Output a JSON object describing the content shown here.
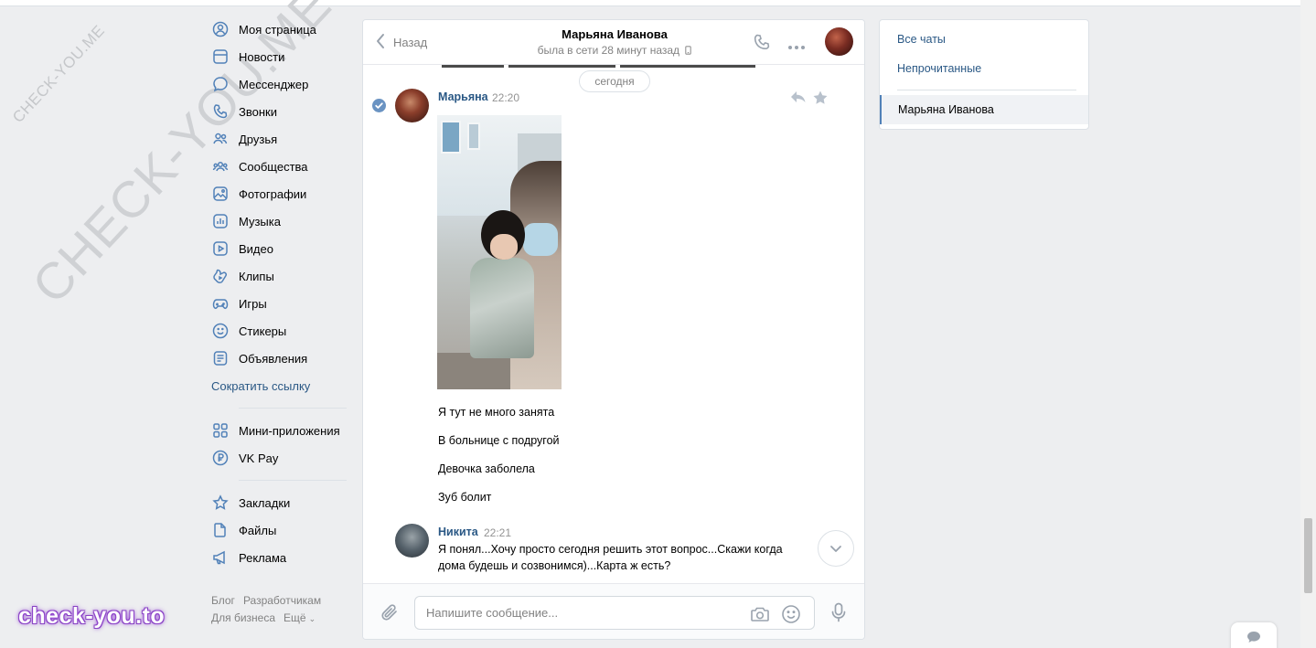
{
  "nav": {
    "items": [
      {
        "label": "Моя страница",
        "icon": "user-circle-icon"
      },
      {
        "label": "Новости",
        "icon": "news-icon"
      },
      {
        "label": "Мессенджер",
        "icon": "message-icon"
      },
      {
        "label": "Звонки",
        "icon": "phone-icon"
      },
      {
        "label": "Друзья",
        "icon": "friends-icon"
      },
      {
        "label": "Сообщества",
        "icon": "communities-icon"
      },
      {
        "label": "Фотографии",
        "icon": "photo-icon"
      },
      {
        "label": "Музыка",
        "icon": "music-icon"
      },
      {
        "label": "Видео",
        "icon": "video-icon"
      },
      {
        "label": "Клипы",
        "icon": "clips-icon"
      },
      {
        "label": "Игры",
        "icon": "gamepad-icon"
      },
      {
        "label": "Стикеры",
        "icon": "smile-icon"
      },
      {
        "label": "Объявления",
        "icon": "ads-icon"
      }
    ],
    "shorten_link": "Сократить ссылку",
    "apps": [
      {
        "label": "Мини-приложения",
        "icon": "apps-grid-icon"
      },
      {
        "label": "VK Pay",
        "icon": "ruble-icon"
      }
    ],
    "extra": [
      {
        "label": "Закладки",
        "icon": "star-icon"
      },
      {
        "label": "Файлы",
        "icon": "file-icon"
      },
      {
        "label": "Реклама",
        "icon": "megaphone-icon"
      }
    ]
  },
  "footer": {
    "blog": "Блог",
    "developers": "Разработчикам",
    "business": "Для бизнеса",
    "more": "Ещё"
  },
  "watermark": {
    "small": "CHECK-YOU.ME",
    "big": "CHECK-YOU.ME",
    "brand": "check-you.to"
  },
  "chat": {
    "back_label": "Назад",
    "peer_name": "Марьяна Иванова",
    "peer_status": "была в сети 28 минут назад",
    "date_divider": "сегодня",
    "messages": [
      {
        "author": "Марьяна",
        "time": "22:20",
        "lines": [
          "Я тут не много занята",
          "В больнице с подругой",
          "Девочка заболела",
          "Зуб болит"
        ]
      },
      {
        "author": "Никита",
        "time": "22:21",
        "text": "Я понял...Хочу просто сегодня решить этот вопрос...Скажи когда дома будешь и созвонимся)...Карта ж есть?"
      }
    ],
    "composer_placeholder": "Напишите сообщение..."
  },
  "right_panel": {
    "all_chats": "Все чаты",
    "unread": "Непрочитанные",
    "active_chat": "Марьяна Иванова"
  },
  "colors": {
    "link": "#2a5885",
    "accent": "#5181b8",
    "background": "#edeef0"
  }
}
